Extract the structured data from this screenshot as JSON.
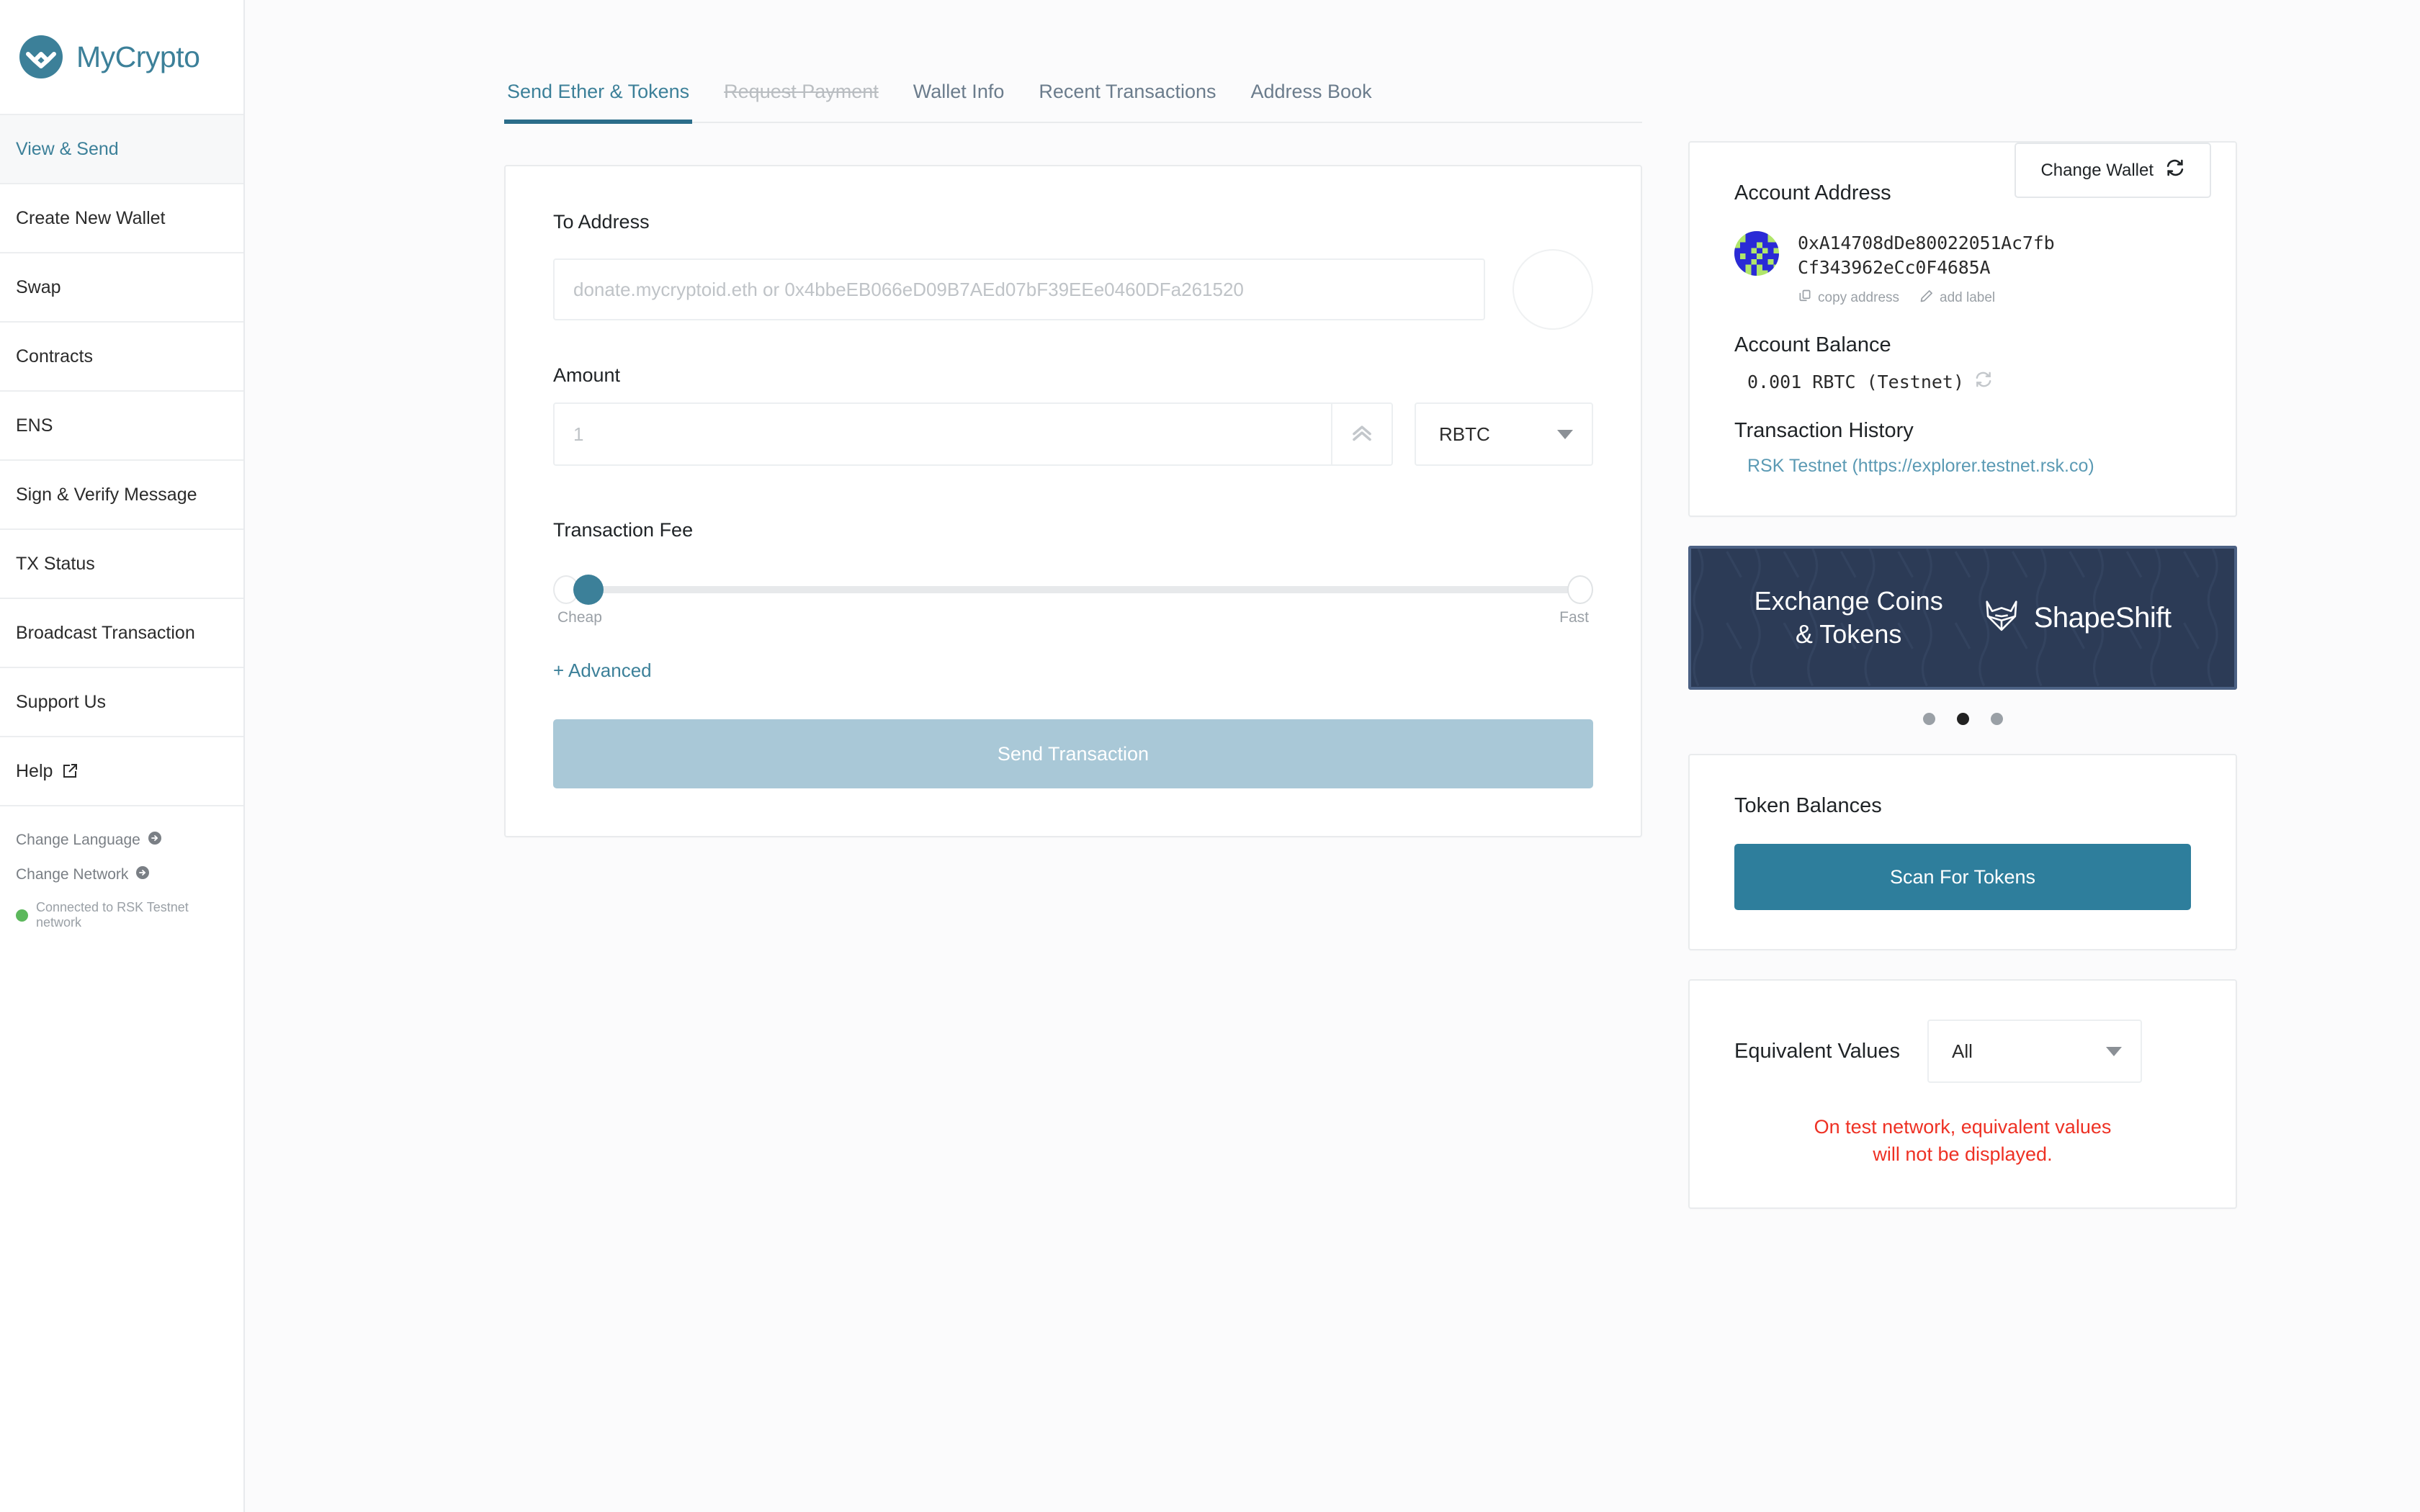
{
  "brand": {
    "name_part1": "My",
    "name_part2": "Crypto"
  },
  "sidebar": {
    "items": [
      {
        "label": "View & Send",
        "active": true
      },
      {
        "label": "Create New Wallet",
        "active": false
      },
      {
        "label": "Swap",
        "active": false
      },
      {
        "label": "Contracts",
        "active": false
      },
      {
        "label": "ENS",
        "active": false
      },
      {
        "label": "Sign & Verify Message",
        "active": false
      },
      {
        "label": "TX Status",
        "active": false
      },
      {
        "label": "Broadcast Transaction",
        "active": false
      },
      {
        "label": "Support Us",
        "active": false
      },
      {
        "label": "Help",
        "active": false,
        "external": true
      }
    ],
    "footer": {
      "change_language": "Change Language",
      "change_network": "Change Network",
      "status": "Connected to RSK Testnet network"
    }
  },
  "header": {
    "change_wallet_label": "Change Wallet"
  },
  "tabs": [
    {
      "label": "Send Ether & Tokens",
      "state": "active"
    },
    {
      "label": "Request Payment",
      "state": "disabled"
    },
    {
      "label": "Wallet Info",
      "state": "normal"
    },
    {
      "label": "Recent Transactions",
      "state": "normal"
    },
    {
      "label": "Address Book",
      "state": "normal"
    }
  ],
  "send_form": {
    "to_address_label": "To Address",
    "to_address_value": "",
    "to_address_placeholder": "donate.mycryptoid.eth or 0x4bbeEB066eD09B7AEd07bF39EEe0460DFa261520",
    "amount_label": "Amount",
    "amount_value": "",
    "amount_placeholder": "1",
    "currency_selected": "RBTC",
    "fee_label": "Transaction Fee",
    "fee_min_label": "Cheap",
    "fee_max_label": "Fast",
    "fee_position_percent": 2,
    "advanced_label": "+ Advanced",
    "send_button_label": "Send Transaction"
  },
  "account": {
    "address_title": "Account Address",
    "address": "0xA14708dDe80022051Ac7fb\nCf343962eCc0F4685A",
    "address_line1": "0xA14708dDe80022051Ac7fb",
    "address_line2": "Cf343962eCc0F4685A",
    "copy_label": "copy address",
    "add_label_label": "add label",
    "balance_title": "Account Balance",
    "balance_value": "0.001 RBTC (Testnet)",
    "history_title": "Transaction History",
    "history_link": "RSK Testnet (https://explorer.testnet.rsk.co)"
  },
  "promo": {
    "line1": "Exchange Coins",
    "line2": "& Tokens",
    "brand": "ShapeShift",
    "dots_count": 3,
    "active_dot": 1
  },
  "tokens": {
    "title": "Token Balances",
    "scan_button_label": "Scan For Tokens"
  },
  "equivalent": {
    "title": "Equivalent Values",
    "selected": "All",
    "warning_line1": "On test network, equivalent values",
    "warning_line2": "will not be displayed."
  },
  "colors": {
    "accent_teal": "#3c8099",
    "scan_button": "#2e7e9c",
    "disabled_button": "#a9c8d7",
    "warning_red": "#ee3124",
    "promo_bg": "#2c3b56",
    "status_green": "#5cb85c"
  }
}
